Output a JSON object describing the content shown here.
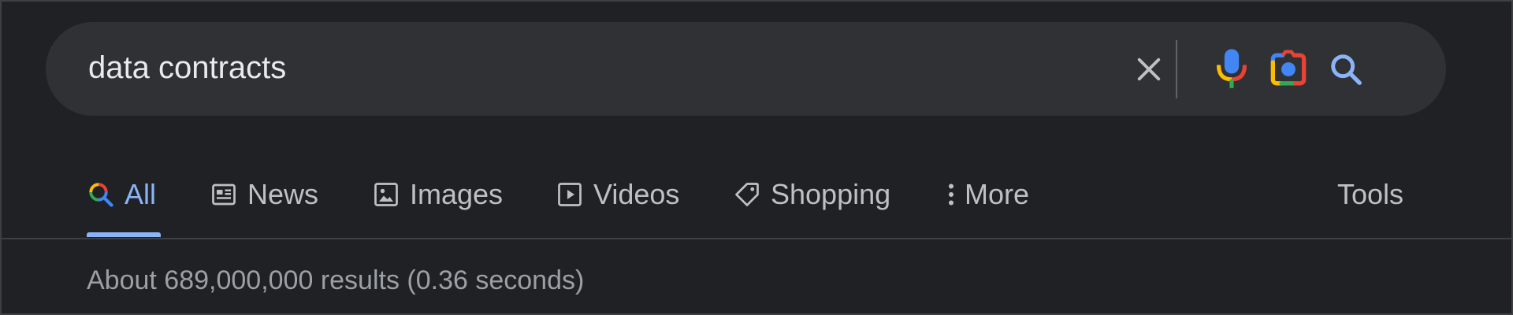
{
  "search": {
    "query": "data contracts",
    "clear_icon": "close-icon",
    "voice_icon": "microphone-icon",
    "lens_icon": "camera-lens-icon",
    "submit_icon": "search-icon"
  },
  "tabs": [
    {
      "label": "All",
      "icon": "google-search-icon",
      "active": true
    },
    {
      "label": "News",
      "icon": "newspaper-icon",
      "active": false
    },
    {
      "label": "Images",
      "icon": "image-icon",
      "active": false
    },
    {
      "label": "Videos",
      "icon": "play-video-icon",
      "active": false
    },
    {
      "label": "Shopping",
      "icon": "tag-icon",
      "active": false
    },
    {
      "label": "More",
      "icon": "more-vert-icon",
      "active": false
    }
  ],
  "tools_label": "Tools",
  "result_stats": "About 689,000,000 results (0.36 seconds)",
  "colors": {
    "background": "#202124",
    "search_bar": "#303134",
    "active_tab": "#8ab4f8",
    "inactive_tab": "#bdc1c6",
    "stats_text": "#9aa0a6",
    "google_blue": "#4285f4",
    "google_red": "#ea4335",
    "google_yellow": "#fbbc04",
    "google_green": "#34a853"
  }
}
